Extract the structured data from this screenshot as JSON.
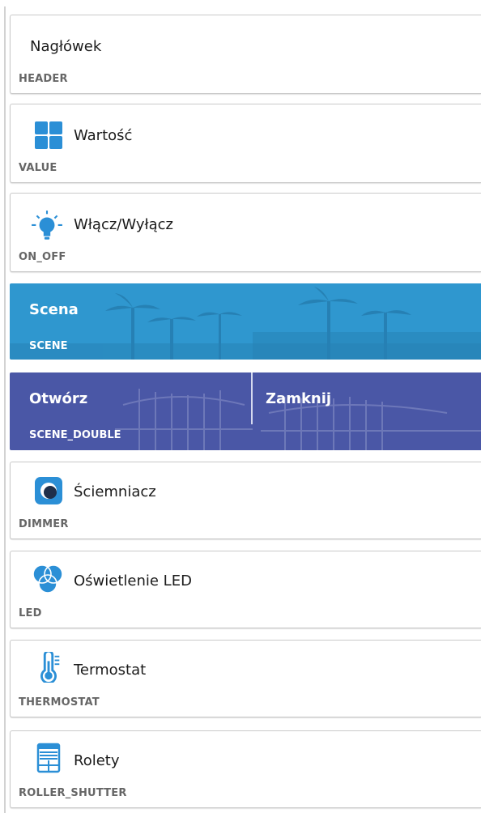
{
  "widgets": [
    {
      "title": "Nagłówek",
      "type": "HEADER",
      "icon": "none"
    },
    {
      "title": "Wartość",
      "type": "VALUE",
      "icon": "grid-icon"
    },
    {
      "title": "Włącz/Wyłącz",
      "type": "ON_OFF",
      "icon": "lightbulb-icon"
    },
    {
      "title": "Scena",
      "type": "SCENE",
      "icon": "none"
    },
    {
      "title_left": "Otwórz",
      "title_right": "Zamknij",
      "type": "SCENE_DOUBLE",
      "icon": "none"
    },
    {
      "title": "Ściemniacz",
      "type": "DIMMER",
      "icon": "dimmer-icon"
    },
    {
      "title": "Oświetlenie LED",
      "type": "LED",
      "icon": "rgb-led-icon"
    },
    {
      "title": "Termostat",
      "type": "THERMOSTAT",
      "icon": "thermometer-icon"
    },
    {
      "title": "Rolety",
      "type": "ROLLER_SHUTTER",
      "icon": "roller-shutter-icon"
    }
  ],
  "colors": {
    "accent_blue": "#2b8fd6",
    "scene_blue": "#2f97cf",
    "scene_double_blue": "#4a57a6"
  }
}
